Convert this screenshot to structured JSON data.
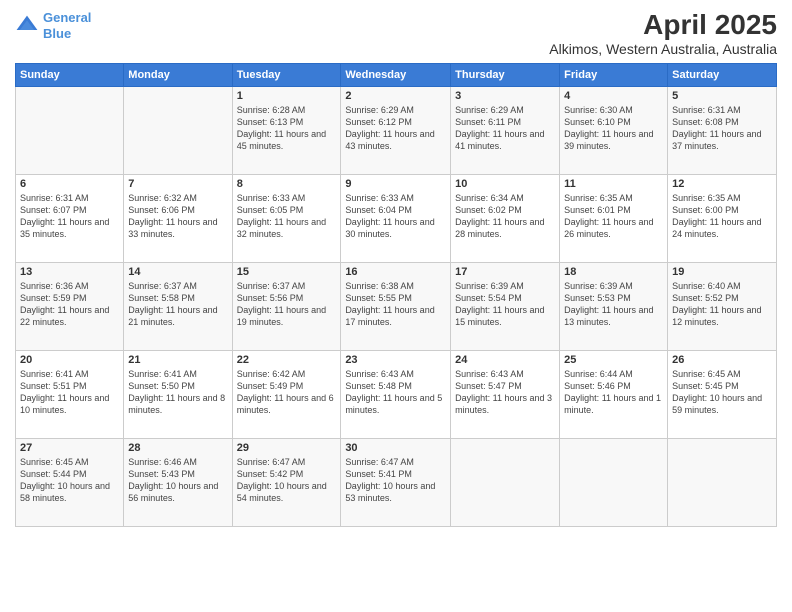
{
  "header": {
    "logo_line1": "General",
    "logo_line2": "Blue",
    "title": "April 2025",
    "subtitle": "Alkimos, Western Australia, Australia"
  },
  "calendar": {
    "days_of_week": [
      "Sunday",
      "Monday",
      "Tuesday",
      "Wednesday",
      "Thursday",
      "Friday",
      "Saturday"
    ],
    "weeks": [
      [
        {
          "day": "",
          "detail": ""
        },
        {
          "day": "",
          "detail": ""
        },
        {
          "day": "1",
          "detail": "Sunrise: 6:28 AM\nSunset: 6:13 PM\nDaylight: 11 hours and 45 minutes."
        },
        {
          "day": "2",
          "detail": "Sunrise: 6:29 AM\nSunset: 6:12 PM\nDaylight: 11 hours and 43 minutes."
        },
        {
          "day": "3",
          "detail": "Sunrise: 6:29 AM\nSunset: 6:11 PM\nDaylight: 11 hours and 41 minutes."
        },
        {
          "day": "4",
          "detail": "Sunrise: 6:30 AM\nSunset: 6:10 PM\nDaylight: 11 hours and 39 minutes."
        },
        {
          "day": "5",
          "detail": "Sunrise: 6:31 AM\nSunset: 6:08 PM\nDaylight: 11 hours and 37 minutes."
        }
      ],
      [
        {
          "day": "6",
          "detail": "Sunrise: 6:31 AM\nSunset: 6:07 PM\nDaylight: 11 hours and 35 minutes."
        },
        {
          "day": "7",
          "detail": "Sunrise: 6:32 AM\nSunset: 6:06 PM\nDaylight: 11 hours and 33 minutes."
        },
        {
          "day": "8",
          "detail": "Sunrise: 6:33 AM\nSunset: 6:05 PM\nDaylight: 11 hours and 32 minutes."
        },
        {
          "day": "9",
          "detail": "Sunrise: 6:33 AM\nSunset: 6:04 PM\nDaylight: 11 hours and 30 minutes."
        },
        {
          "day": "10",
          "detail": "Sunrise: 6:34 AM\nSunset: 6:02 PM\nDaylight: 11 hours and 28 minutes."
        },
        {
          "day": "11",
          "detail": "Sunrise: 6:35 AM\nSunset: 6:01 PM\nDaylight: 11 hours and 26 minutes."
        },
        {
          "day": "12",
          "detail": "Sunrise: 6:35 AM\nSunset: 6:00 PM\nDaylight: 11 hours and 24 minutes."
        }
      ],
      [
        {
          "day": "13",
          "detail": "Sunrise: 6:36 AM\nSunset: 5:59 PM\nDaylight: 11 hours and 22 minutes."
        },
        {
          "day": "14",
          "detail": "Sunrise: 6:37 AM\nSunset: 5:58 PM\nDaylight: 11 hours and 21 minutes."
        },
        {
          "day": "15",
          "detail": "Sunrise: 6:37 AM\nSunset: 5:56 PM\nDaylight: 11 hours and 19 minutes."
        },
        {
          "day": "16",
          "detail": "Sunrise: 6:38 AM\nSunset: 5:55 PM\nDaylight: 11 hours and 17 minutes."
        },
        {
          "day": "17",
          "detail": "Sunrise: 6:39 AM\nSunset: 5:54 PM\nDaylight: 11 hours and 15 minutes."
        },
        {
          "day": "18",
          "detail": "Sunrise: 6:39 AM\nSunset: 5:53 PM\nDaylight: 11 hours and 13 minutes."
        },
        {
          "day": "19",
          "detail": "Sunrise: 6:40 AM\nSunset: 5:52 PM\nDaylight: 11 hours and 12 minutes."
        }
      ],
      [
        {
          "day": "20",
          "detail": "Sunrise: 6:41 AM\nSunset: 5:51 PM\nDaylight: 11 hours and 10 minutes."
        },
        {
          "day": "21",
          "detail": "Sunrise: 6:41 AM\nSunset: 5:50 PM\nDaylight: 11 hours and 8 minutes."
        },
        {
          "day": "22",
          "detail": "Sunrise: 6:42 AM\nSunset: 5:49 PM\nDaylight: 11 hours and 6 minutes."
        },
        {
          "day": "23",
          "detail": "Sunrise: 6:43 AM\nSunset: 5:48 PM\nDaylight: 11 hours and 5 minutes."
        },
        {
          "day": "24",
          "detail": "Sunrise: 6:43 AM\nSunset: 5:47 PM\nDaylight: 11 hours and 3 minutes."
        },
        {
          "day": "25",
          "detail": "Sunrise: 6:44 AM\nSunset: 5:46 PM\nDaylight: 11 hours and 1 minute."
        },
        {
          "day": "26",
          "detail": "Sunrise: 6:45 AM\nSunset: 5:45 PM\nDaylight: 10 hours and 59 minutes."
        }
      ],
      [
        {
          "day": "27",
          "detail": "Sunrise: 6:45 AM\nSunset: 5:44 PM\nDaylight: 10 hours and 58 minutes."
        },
        {
          "day": "28",
          "detail": "Sunrise: 6:46 AM\nSunset: 5:43 PM\nDaylight: 10 hours and 56 minutes."
        },
        {
          "day": "29",
          "detail": "Sunrise: 6:47 AM\nSunset: 5:42 PM\nDaylight: 10 hours and 54 minutes."
        },
        {
          "day": "30",
          "detail": "Sunrise: 6:47 AM\nSunset: 5:41 PM\nDaylight: 10 hours and 53 minutes."
        },
        {
          "day": "",
          "detail": ""
        },
        {
          "day": "",
          "detail": ""
        },
        {
          "day": "",
          "detail": ""
        }
      ]
    ]
  }
}
